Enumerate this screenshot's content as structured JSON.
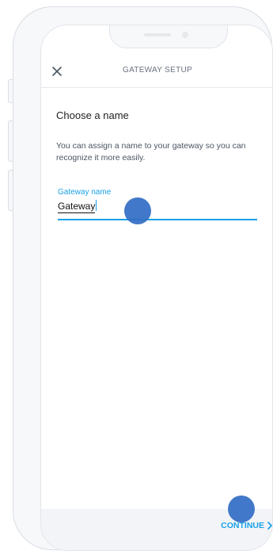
{
  "header": {
    "title": "GATEWAY SETUP",
    "close_icon": "close-icon"
  },
  "content": {
    "title": "Choose a name",
    "description": "You can assign a name to your gateway so you can recognize it more easily.",
    "field": {
      "label": "Gateway name",
      "value": "Gateway"
    }
  },
  "footer": {
    "continue_label": "CONTINUE",
    "continue_icon": "chevron-right-icon"
  },
  "colors": {
    "accent": "#1aa1e6",
    "touch_indicator": "#346ec5"
  }
}
